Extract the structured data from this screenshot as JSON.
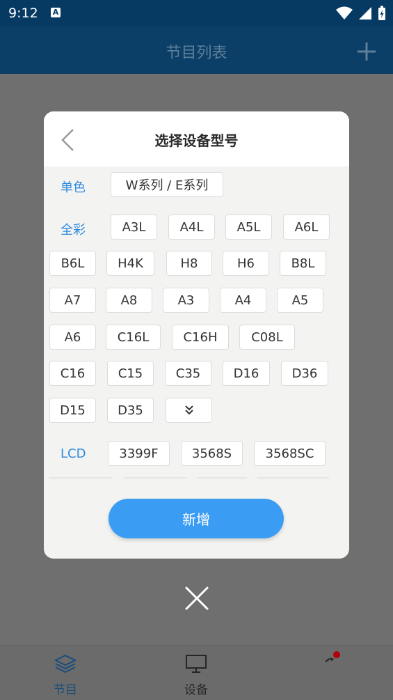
{
  "status_bar": {
    "time": "9:12",
    "notif_letter": "A"
  },
  "header": {
    "title": "节目列表"
  },
  "dialog": {
    "title": "选择设备型号",
    "sections": {
      "mono_label": "单色",
      "fullcolor_label": "全彩",
      "lcd_label": "LCD"
    },
    "mono_chips": [
      "W系列 / E系列"
    ],
    "fullcolor_chips": [
      "A3L",
      "A4L",
      "A5L",
      "A6L",
      "B6L",
      "H4K",
      "H8",
      "H6",
      "B8L",
      "A7",
      "A8",
      "A3",
      "A4",
      "A5",
      "A6",
      "C16L",
      "C16H",
      "C08L",
      "C16",
      "C15",
      "C35",
      "D16",
      "D36",
      "D15",
      "D35"
    ],
    "lcd_chips": [
      "3399F",
      "3568S",
      "3568SC"
    ],
    "add_button": "新增"
  },
  "bottom_nav": {
    "items": [
      {
        "label": "节目"
      },
      {
        "label": "设备"
      }
    ]
  },
  "colors": {
    "accent": "#3b9cf4",
    "label": "#2d8ae0",
    "header": "#0c3f67"
  }
}
